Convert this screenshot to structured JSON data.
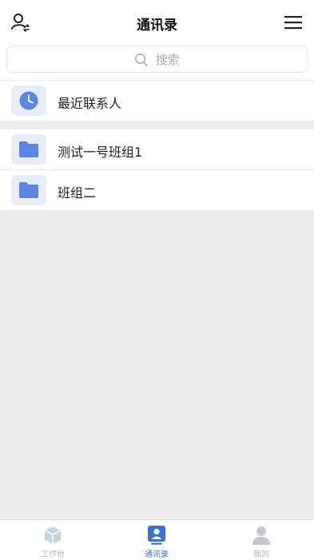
{
  "header": {
    "title": "通讯录"
  },
  "search": {
    "placeholder": "搜索"
  },
  "recent": {
    "label": "最近联系人"
  },
  "groups": [
    {
      "label": "测试一号班组1"
    },
    {
      "label": "班组二"
    }
  ],
  "tabs": [
    {
      "label": "工作台",
      "icon": "cube-icon"
    },
    {
      "label": "通讯录",
      "icon": "contacts-icon"
    },
    {
      "label": "我的",
      "icon": "person-icon"
    }
  ],
  "colors": {
    "accent": "#3a6fd8",
    "folder": "#5b86e5",
    "icon_bg": "#e6edf8",
    "page_bg": "#ededed",
    "tab_inactive": "#b7b7b7"
  }
}
